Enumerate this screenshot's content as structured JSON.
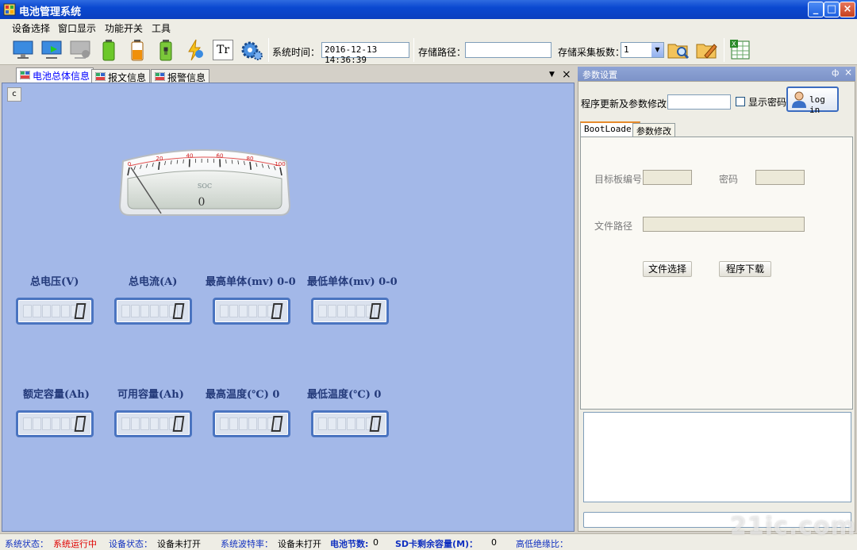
{
  "window": {
    "title": "电池管理系统"
  },
  "menu": [
    "设备选择",
    "窗口显示",
    "功能开关",
    "工具"
  ],
  "toolbar": {
    "icons": [
      "monitor-icon",
      "monitor-connect-icon",
      "monitor-disabled-icon",
      "battery-full-icon",
      "battery-half-icon",
      "battery-charge-icon",
      "lightning-icon",
      "text-tr-icon",
      "gear-icon"
    ],
    "tr_text": "Tr",
    "system_time_label": "系统时间：",
    "system_time_value": "2016-12-13 14:36:39",
    "storage_path_label": "存储路径：",
    "storage_path_value": "",
    "boards_label": "存储采集板数：",
    "boards_value": "1",
    "colors": {
      "accent": "#0a48d0"
    }
  },
  "left_tabs": [
    {
      "label": "电池总体信息",
      "active": true
    },
    {
      "label": "报文信息",
      "active": false
    },
    {
      "label": "报警信息",
      "active": false
    }
  ],
  "left_panel": {
    "c_button": "c",
    "gauge": {
      "label": "SOC",
      "value": "0",
      "level": 0,
      "ticks": [
        "0",
        "20",
        "40",
        "60",
        "80",
        "100"
      ]
    },
    "metrics": [
      {
        "label": "总电压(V)",
        "value": "0"
      },
      {
        "label": "总电流(A)",
        "value": "0"
      },
      {
        "label": "最高单体(mv) 0-0",
        "value": "0"
      },
      {
        "label": "最低单体(mv) 0-0",
        "value": "0"
      },
      {
        "label": "额定容量(Ah)",
        "value": "0"
      },
      {
        "label": "可用容量(Ah)",
        "value": "0"
      },
      {
        "label": "最高温度(℃) 0",
        "value": "0"
      },
      {
        "label": "最低温度(℃) 0",
        "value": "0"
      }
    ]
  },
  "right_panel": {
    "title": "参数设置",
    "pin": "ф",
    "close": "×",
    "update_label": "程序更新及参数修改",
    "update_value": "",
    "show_password_label": "显示密码",
    "login_label": "log in",
    "tabs": [
      {
        "label": "BootLoader",
        "active": true
      },
      {
        "label": "参数修改",
        "active": false
      }
    ],
    "board_id_label": "目标板编号",
    "password_label": "密码",
    "file_path_label": "文件路径",
    "file_select_button": "文件选择",
    "download_button": "程序下载"
  },
  "statusbar": {
    "sys_state_label": "系统状态：",
    "sys_state_value": "系统运行中",
    "dev_state_label": "设备状态：",
    "dev_state_value": "设备未打开",
    "baud_label": "系统波特率：",
    "baud_value": "设备未打开",
    "cells_label": "电池节数:",
    "cells_value": "0",
    "sd_label": "SD卡剩余容量(M)：",
    "sd_value": "0",
    "insulation_label": "高低绝缘比："
  },
  "watermark": "21ic.com"
}
